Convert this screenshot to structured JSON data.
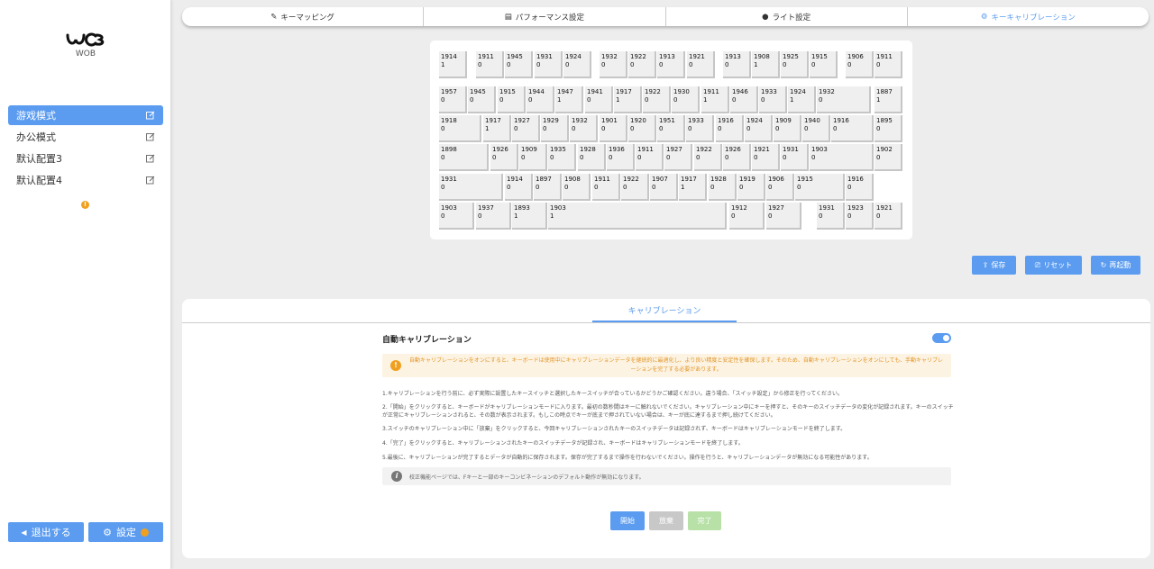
{
  "app": {
    "brand": "WOB",
    "accent": "#5b9cf0",
    "warning": "#f0a020"
  },
  "sidebar": {
    "modes": [
      {
        "label": "游戏模式",
        "active": true
      },
      {
        "label": "办公模式",
        "active": false
      },
      {
        "label": "默认配置3",
        "active": false
      },
      {
        "label": "默认配置4",
        "active": false
      }
    ],
    "exit_label": "退出する",
    "settings_label": "設定"
  },
  "tabs": [
    {
      "label": "キーマッピング",
      "icon": "pencil-icon"
    },
    {
      "label": "パフォーマンス設定",
      "icon": "keyboard-icon"
    },
    {
      "label": "ライト設定",
      "icon": "bulb-icon"
    },
    {
      "label": "キーキャリブレーション",
      "icon": "gear-icon",
      "active": true
    }
  ],
  "keyboard": {
    "rows": [
      [
        [
          "1914",
          "1"
        ],
        [
          "1911",
          "0"
        ],
        [
          "1945",
          "0"
        ],
        [
          "1931",
          "0"
        ],
        [
          "1924",
          "0"
        ],
        [
          "1932",
          "0"
        ],
        [
          "1922",
          "0"
        ],
        [
          "1913",
          "0"
        ],
        [
          "1921",
          "0"
        ],
        [
          "1913",
          "0"
        ],
        [
          "1908",
          "1"
        ],
        [
          "1925",
          "0"
        ],
        [
          "1915",
          "0"
        ],
        [
          "1906",
          "0"
        ],
        [
          "1911",
          "0"
        ]
      ],
      [
        [
          "1957",
          "0"
        ],
        [
          "1945",
          "0"
        ],
        [
          "1915",
          "0"
        ],
        [
          "1944",
          "0"
        ],
        [
          "1947",
          "1"
        ],
        [
          "1941",
          "0"
        ],
        [
          "1917",
          "1"
        ],
        [
          "1922",
          "0"
        ],
        [
          "1930",
          "0"
        ],
        [
          "1911",
          "1"
        ],
        [
          "1946",
          "0"
        ],
        [
          "1933",
          "0"
        ],
        [
          "1924",
          "1"
        ],
        [
          "1932",
          "0"
        ],
        [
          "1887",
          "1"
        ]
      ],
      [
        [
          "1918",
          "0"
        ],
        [
          "1917",
          "1"
        ],
        [
          "1927",
          "0"
        ],
        [
          "1929",
          "0"
        ],
        [
          "1932",
          "0"
        ],
        [
          "1901",
          "0"
        ],
        [
          "1920",
          "0"
        ],
        [
          "1951",
          "0"
        ],
        [
          "1933",
          "0"
        ],
        [
          "1916",
          "0"
        ],
        [
          "1924",
          "0"
        ],
        [
          "1909",
          "0"
        ],
        [
          "1940",
          "0"
        ],
        [
          "1916",
          "0"
        ],
        [
          "1895",
          "0"
        ]
      ],
      [
        [
          "1898",
          "0"
        ],
        [
          "1926",
          "0"
        ],
        [
          "1909",
          "0"
        ],
        [
          "1935",
          "0"
        ],
        [
          "1928",
          "0"
        ],
        [
          "1936",
          "0"
        ],
        [
          "1911",
          "0"
        ],
        [
          "1927",
          "0"
        ],
        [
          "1922",
          "0"
        ],
        [
          "1926",
          "0"
        ],
        [
          "1921",
          "0"
        ],
        [
          "1931",
          "0"
        ],
        [
          "1903",
          "0"
        ],
        [
          "1902",
          "0"
        ]
      ],
      [
        [
          "1931",
          "0"
        ],
        [
          "1914",
          "0"
        ],
        [
          "1897",
          "0"
        ],
        [
          "1908",
          "0"
        ],
        [
          "1911",
          "0"
        ],
        [
          "1922",
          "0"
        ],
        [
          "1907",
          "0"
        ],
        [
          "1917",
          "1"
        ],
        [
          "1928",
          "0"
        ],
        [
          "1919",
          "0"
        ],
        [
          "1906",
          "0"
        ],
        [
          "1915",
          "0"
        ],
        [
          "1916",
          "0"
        ]
      ],
      [
        [
          "1903",
          "0"
        ],
        [
          "1937",
          "0"
        ],
        [
          "1893",
          "1"
        ],
        [
          "1903",
          "1"
        ],
        [
          "1912",
          "0"
        ],
        [
          "1927",
          "0"
        ],
        [
          "1931",
          "0"
        ],
        [
          "1923",
          "0"
        ],
        [
          "1921",
          "0"
        ]
      ]
    ]
  },
  "actions": {
    "save": "保存",
    "reset": "リセット",
    "restart": "再起動"
  },
  "calibration": {
    "tab_label": "キャリブレーション",
    "auto_label": "自動キャリブレーション",
    "auto_enabled": true,
    "notice": "自動キャリブレーションをオンにすると、キーボードは使用中にキャリブレーションデータを継続的に最適化し、より良い精度と安定性を確保します。そのため、自動キャリブレーションをオンにしても、手動キャリブレーションを完了する必要があります。",
    "instructions": [
      "1.キャリブレーションを行う前に、必ず実際に設置したキースイッチと選択したキースイッチが合っているかどうかご確認ください。違う場合、「スイッチ設定」から修正を行ってください。",
      "2.「開始」をクリックすると、キーボードがキャリブレーションモードに入ります。最初の数秒間はキーに触れないでください。キャリブレーション中にキーを押すと、そのキーのスイッチデータの変化が記録されます。キーのスイッチが正常にキャリブレーションされると、その数が表示されます。もしこの時点でキーが底まで押されていない場合は、キーが底に達するまで押し続けてください。",
      "3.スイッチのキャリブレーション中に「放棄」をクリックすると、今回キャリブレーションされたキーのスイッチデータは記録されず、キーボードはキャリブレーションモードを終了します。",
      "4.「完了」をクリックすると、キャリブレーションされたキーのスイッチデータが記録され、キーボードはキャリブレーションモードを終了します。",
      "5.最後に、キャリブレーションが完了するとデータが自動的に保存されます。保存が完了するまで操作を行わないでください。操作を行うと、キャリブレーションデータが無効になる可能性があります。"
    ],
    "info": "校正機能ページでは、Fキーと一部のキーコンビネーションのデフォルト動作が無効になります。",
    "start": "開始",
    "abandon": "放棄",
    "finish": "完了"
  }
}
